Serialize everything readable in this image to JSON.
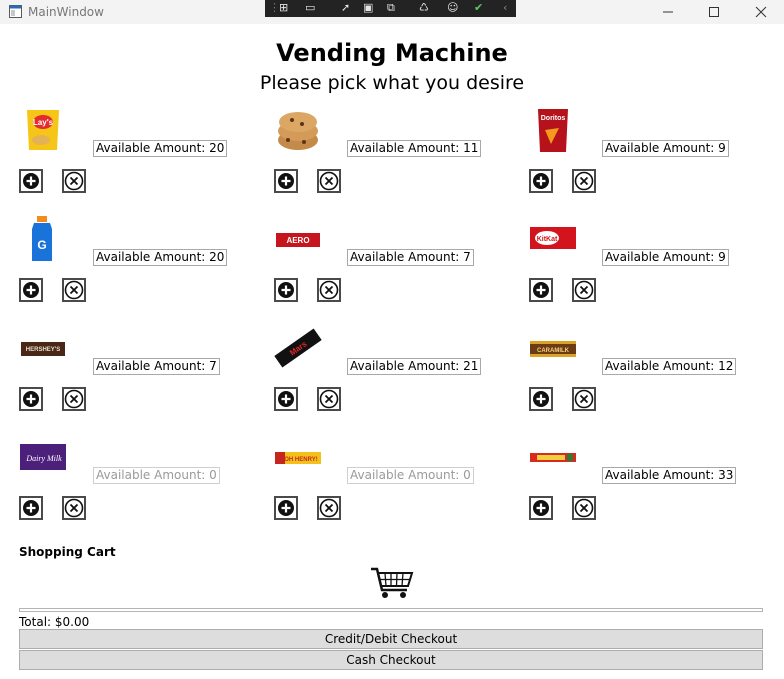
{
  "window": {
    "title": "MainWindow"
  },
  "heading": "Vending Machine",
  "subheading": "Please pick what you desire",
  "products": [
    {
      "icon": "lays-chips-icon",
      "amount_label": "Available Amount: 20",
      "available": true
    },
    {
      "icon": "cookies-icon",
      "amount_label": "Available Amount: 11",
      "available": true
    },
    {
      "icon": "doritos-chips-icon",
      "amount_label": "Available Amount: 9",
      "available": true
    },
    {
      "icon": "gatorade-bottle-icon",
      "amount_label": "Available Amount: 20",
      "available": true
    },
    {
      "icon": "aero-bar-icon",
      "amount_label": "Available Amount: 7",
      "available": true
    },
    {
      "icon": "kitkat-bar-icon",
      "amount_label": "Available Amount: 9",
      "available": true
    },
    {
      "icon": "hersheys-bar-icon",
      "amount_label": "Available Amount: 7",
      "available": true
    },
    {
      "icon": "mars-bar-icon",
      "amount_label": "Available Amount: 21",
      "available": true
    },
    {
      "icon": "caramilk-bar-icon",
      "amount_label": "Available Amount: 12",
      "available": true
    },
    {
      "icon": "dairy-milk-bar-icon",
      "amount_label": "Available Amount: 0",
      "available": false
    },
    {
      "icon": "oh-henry-bar-icon",
      "amount_label": "Available Amount: 0",
      "available": false
    },
    {
      "icon": "coffee-crisp-bar-icon",
      "amount_label": "Available Amount: 33",
      "available": true
    }
  ],
  "product_logos": {
    "chips": "Lay's",
    "doritos": "Doritos",
    "gatorade": "G",
    "aero": "AERO",
    "kitkat": "KitKat",
    "hersheys": "HERSHEY'S",
    "mars": "Mars",
    "caramilk": "CARAMILK",
    "dairy_milk": "Dairy Milk",
    "oh_henry": "OH HENRY!"
  },
  "cart": {
    "label": "Shopping Cart",
    "total": "Total: $0.00"
  },
  "buttons": {
    "card_checkout": "Credit/Debit Checkout",
    "cash_checkout": "Cash Checkout"
  },
  "colors": {
    "titlebar": "#f3f3f3",
    "button_face": "#dddddd",
    "debug_toolbar": "#232323"
  }
}
